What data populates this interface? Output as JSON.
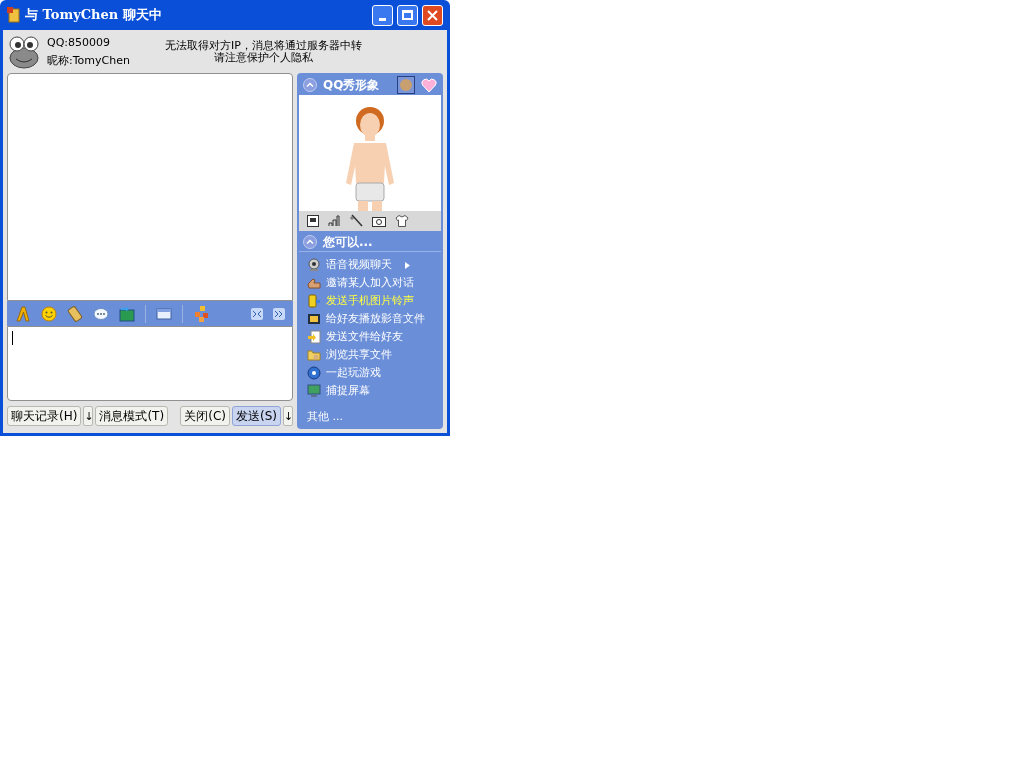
{
  "window": {
    "title": "与 TomyChen 聊天中"
  },
  "contact": {
    "qq": "QQ:850009",
    "nickname": "昵称:TomyChen"
  },
  "notice": [
    "无法取得对方IP，消息将通过服务器中转",
    "请注意保护个人隐私"
  ],
  "toolbar": [
    {
      "kind": "font"
    },
    {
      "kind": "emoticon"
    },
    {
      "kind": "phone"
    },
    {
      "kind": "bubble"
    },
    {
      "kind": "image"
    },
    {
      "kind": "sep"
    },
    {
      "kind": "card"
    },
    {
      "kind": "sep"
    },
    {
      "kind": "apps"
    }
  ],
  "buttons_left": [
    {
      "label": "聊天记录(H)",
      "dropdown": "↓"
    },
    {
      "label": "消息模式(T)"
    }
  ],
  "buttons_right": [
    {
      "label": "关闭(C)",
      "selected": false
    },
    {
      "label": "发送(S)",
      "selected": true,
      "dropdown": "↓"
    }
  ],
  "show_panel": {
    "title": "QQ秀形象",
    "expanded": true
  },
  "actions_panel": {
    "title": "您可以...",
    "expanded": true,
    "more": "其他 ...",
    "items": [
      {
        "label": "语音视频聊天",
        "kind": "webcam",
        "submenu": true,
        "highlighted": false
      },
      {
        "label": "邀请某人加入对话",
        "kind": "hand",
        "submenu": false,
        "highlighted": false
      },
      {
        "label": "发送手机图片铃声",
        "kind": "phone",
        "submenu": false,
        "highlighted": true
      },
      {
        "label": "给好友播放影音文件",
        "kind": "media",
        "submenu": false,
        "highlighted": false
      },
      {
        "label": "发送文件给好友",
        "kind": "file",
        "submenu": false,
        "highlighted": false
      },
      {
        "label": "浏览共享文件",
        "kind": "folder",
        "submenu": false,
        "highlighted": false
      },
      {
        "label": "一起玩游戏",
        "kind": "game",
        "submenu": false,
        "highlighted": false
      },
      {
        "label": "捕捉屏幕",
        "kind": "screen",
        "submenu": false,
        "highlighted": false
      }
    ]
  }
}
